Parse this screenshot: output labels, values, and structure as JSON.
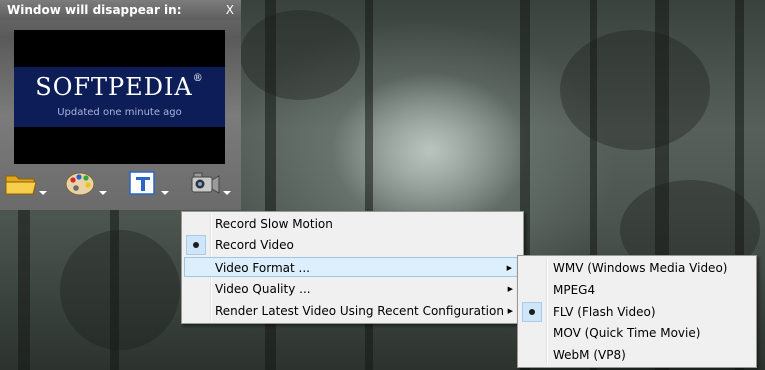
{
  "panel": {
    "title": "Window will disappear in:",
    "close_label": "X",
    "logo": {
      "brand": "SOFTPEDIA",
      "registered": "®",
      "tagline": "Updated one minute ago"
    },
    "tools": [
      {
        "name": "folder-icon"
      },
      {
        "name": "palette-icon"
      },
      {
        "name": "text-tool-icon"
      },
      {
        "name": "video-camera-icon"
      }
    ]
  },
  "menu": {
    "items": [
      {
        "label": "Record Slow Motion",
        "checked": false,
        "submenu": false
      },
      {
        "label": "Record Video",
        "checked": true,
        "submenu": false
      },
      {
        "label": "Video Format ...",
        "checked": false,
        "submenu": true,
        "highlighted": true
      },
      {
        "label": "Video Quality ...",
        "checked": false,
        "submenu": true
      },
      {
        "label": "Render Latest Video Using Recent Configuration",
        "checked": false,
        "submenu": true
      }
    ],
    "submenu_arrow": "▶"
  },
  "format_menu": {
    "items": [
      {
        "label": "WMV (Windows Media Video)",
        "checked": false
      },
      {
        "label": "MPEG4",
        "checked": false
      },
      {
        "label": "FLV (Flash Video)",
        "checked": true
      },
      {
        "label": "MOV (Quick Time Movie)",
        "checked": false
      },
      {
        "label": "WebM (VP8)",
        "checked": false
      }
    ]
  },
  "colors": {
    "logo_bg": "#0d1d58",
    "menu_bg": "#f0f0f0",
    "highlight": "#ddeefc"
  }
}
